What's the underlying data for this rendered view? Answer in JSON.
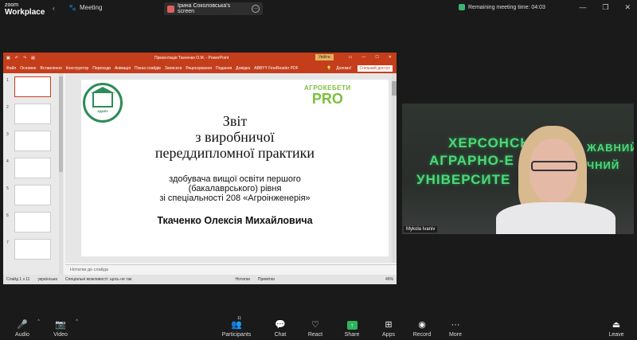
{
  "app": {
    "brand_line1": "zoom",
    "brand_line2": "Workplace"
  },
  "topbar": {
    "meeting_label": "Meeting",
    "share_label": "Ірина Соколовська's screen",
    "remaining_label": "Remaining meeting time: 04:03"
  },
  "ppt": {
    "doc_title": "Презентація Ткаченко О.М. - PowerPoint",
    "signin": "Увійти",
    "menu": [
      "Файл",
      "Основне",
      "Вставлення",
      "Конструктор",
      "Переходи",
      "Анімація",
      "Показ слайдів",
      "Записати",
      "Рецензування",
      "Подання",
      "Довідка",
      "ABBYY FineReader PDF"
    ],
    "help_label": "Допомо!",
    "share_btn": "Спільний доступ",
    "thumb_numbers": [
      "1",
      "2",
      "3",
      "4",
      "5",
      "6",
      "7"
    ],
    "notes_placeholder": "Нотатки до слайда",
    "status_slide": "Слайд 1 з 11",
    "status_lang": "українська",
    "status_access": "Спеціальні можливості: щось не так",
    "status_notes": "Нотатки",
    "status_comments": "Примітки",
    "zoom": "46%"
  },
  "slide": {
    "logo_text": "ХДАЕУ",
    "agro_top": "АГРОКЕБЕТИ",
    "agro_bottom": "PRO",
    "title_1": "Звіт",
    "title_2": "з виробничої",
    "title_3": "переддипломної практики",
    "sub_1": "здобувача вищої освіти першого",
    "sub_2": "(бакалаврського) рівня",
    "sub_3": "зі  спеціальності 208 «Агроінженерія»",
    "name": "Ткаченко Олексія Михайловича"
  },
  "video": {
    "wall_line1": "ХЕРСОНСЬ",
    "wall_line1b": "ЖАВНИЙ",
    "wall_line2": "АГРАРНО-Е",
    "wall_line2b": "ЧНИЙ",
    "wall_line3": "УНІВЕРСИТЕ",
    "participant_name": "Mykola Ivaniv"
  },
  "toolbar": {
    "audio": "Audio",
    "video": "Video",
    "participants": "Participants",
    "participants_count": "11",
    "chat": "Chat",
    "react": "React",
    "share": "Share",
    "apps": "Apps",
    "record": "Record",
    "more": "More",
    "leave": "Leave"
  },
  "colors": {
    "ppt_accent": "#c43e1c",
    "share_green": "#2db55d",
    "wall_text": "#4fd67a",
    "agro_green": "#7dbf3a"
  }
}
